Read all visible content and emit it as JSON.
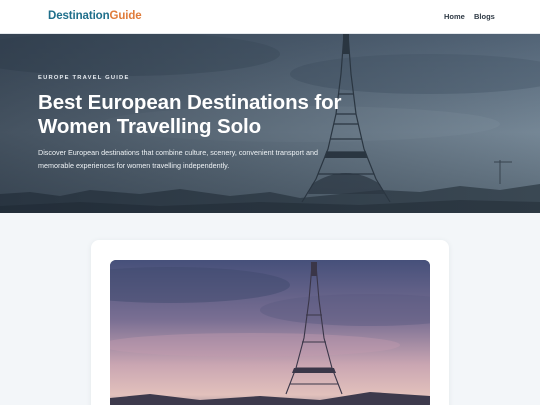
{
  "header": {
    "logo_part1": "Destination",
    "logo_part2": "Guide",
    "nav": [
      {
        "label": "Home"
      },
      {
        "label": "Blogs"
      }
    ]
  },
  "hero": {
    "eyebrow": "EUROPE TRAVEL GUIDE",
    "title": "Best European Destinations for Women Travelling Solo",
    "description": "Discover European destinations that combine culture, scenery, convenient transport and memorable experiences for women travelling independently."
  },
  "colors": {
    "brand_primary": "#1f6f8b",
    "brand_accent": "#e07b39",
    "page_background": "#f3f6f9"
  }
}
